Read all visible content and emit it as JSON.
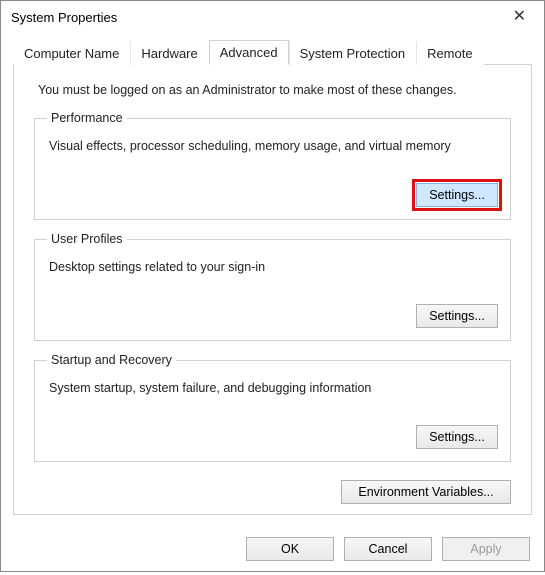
{
  "window": {
    "title": "System Properties"
  },
  "tabs": {
    "computer_name": "Computer Name",
    "hardware": "Hardware",
    "advanced": "Advanced",
    "system_protection": "System Protection",
    "remote": "Remote"
  },
  "advanced": {
    "intro": "You must be logged on as an Administrator to make most of these changes.",
    "performance": {
      "legend": "Performance",
      "desc": "Visual effects, processor scheduling, memory usage, and virtual memory",
      "button": "Settings..."
    },
    "user_profiles": {
      "legend": "User Profiles",
      "desc": "Desktop settings related to your sign-in",
      "button": "Settings..."
    },
    "startup_recovery": {
      "legend": "Startup and Recovery",
      "desc": "System startup, system failure, and debugging information",
      "button": "Settings..."
    },
    "env_vars_button": "Environment Variables..."
  },
  "footer": {
    "ok": "OK",
    "cancel": "Cancel",
    "apply": "Apply"
  }
}
